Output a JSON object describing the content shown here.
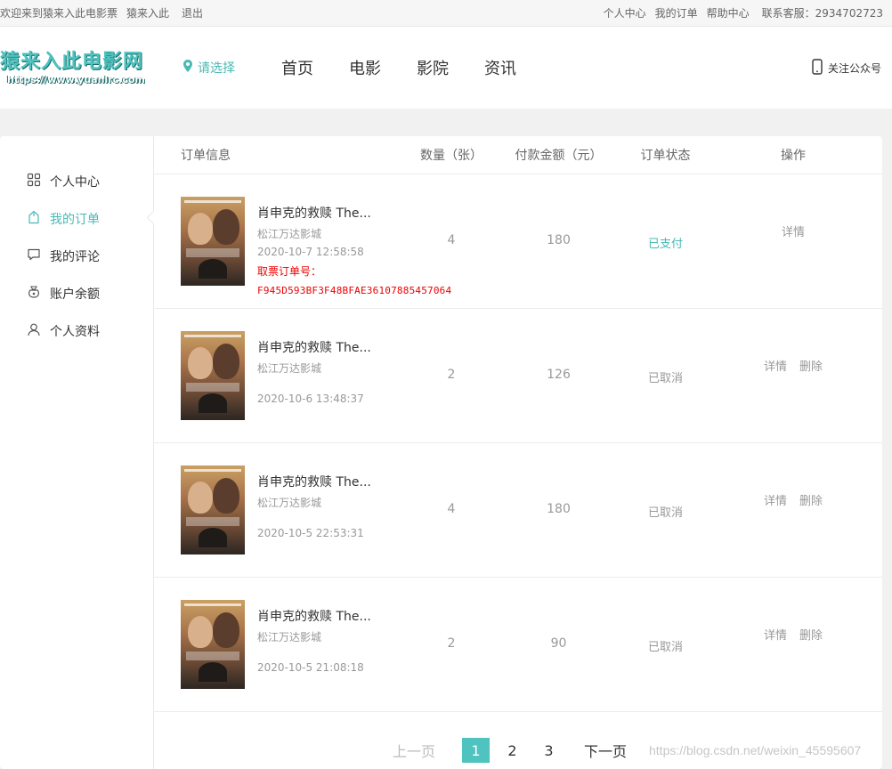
{
  "topbar": {
    "welcome": "欢迎来到猿来入此电影票",
    "username": "猿来入此",
    "logout": "退出",
    "links": [
      "个人中心",
      "我的订单",
      "帮助中心"
    ],
    "hotline": "联系客服：2934702723"
  },
  "header": {
    "brand": "猿来入此电影网",
    "url": "https://www.yuanlrc.com",
    "city": "请选择",
    "nav": [
      "首页",
      "电影",
      "影院",
      "资讯"
    ],
    "follow": "关注公众号"
  },
  "sidebar": {
    "items": [
      {
        "label": "个人中心",
        "icon": "grid-icon",
        "active": false
      },
      {
        "label": "我的订单",
        "icon": "order-icon",
        "active": true
      },
      {
        "label": "我的评论",
        "icon": "comment-icon",
        "active": false
      },
      {
        "label": "账户余额",
        "icon": "wallet-icon",
        "active": false
      },
      {
        "label": "个人资料",
        "icon": "user-icon",
        "active": false
      }
    ]
  },
  "table": {
    "headers": {
      "info": "订单信息",
      "qty": "数量（张）",
      "amount": "付款金额（元）",
      "status": "订单状态",
      "op": "操作"
    },
    "rows": [
      {
        "movie": "肖申克的救赎 The...",
        "cinema": "松江万达影城",
        "time": "2020-10-7 12:58:58",
        "ticket_label": "取票订单号：",
        "ticket_code": "F945D593BF3F48BFAE36107885457064",
        "qty": "4",
        "amount": "180",
        "status": "已支付",
        "actions": [
          "详情"
        ]
      },
      {
        "movie": "肖申克的救赎 The...",
        "cinema": "松江万达影城",
        "time": "2020-10-6 13:48:37",
        "qty": "2",
        "amount": "126",
        "status": "已取消",
        "actions": [
          "详情",
          "删除"
        ]
      },
      {
        "movie": "肖申克的救赎 The...",
        "cinema": "松江万达影城",
        "time": "2020-10-5 22:53:31",
        "qty": "4",
        "amount": "180",
        "status": "已取消",
        "actions": [
          "详情",
          "删除"
        ]
      },
      {
        "movie": "肖申克的救赎 The...",
        "cinema": "松江万达影城",
        "time": "2020-10-5 21:08:18",
        "qty": "2",
        "amount": "90",
        "status": "已取消",
        "actions": [
          "详情",
          "删除"
        ]
      }
    ]
  },
  "pager": {
    "prev": "上一页",
    "pages": [
      "1",
      "2",
      "3"
    ],
    "current": "1",
    "next": "下一页"
  },
  "watermark": "https://blog.csdn.net/weixin_45595607",
  "colors": {
    "accent": "#49b9b5",
    "pager_active": "#4ec3bf",
    "ticket_red": "#e00000"
  }
}
